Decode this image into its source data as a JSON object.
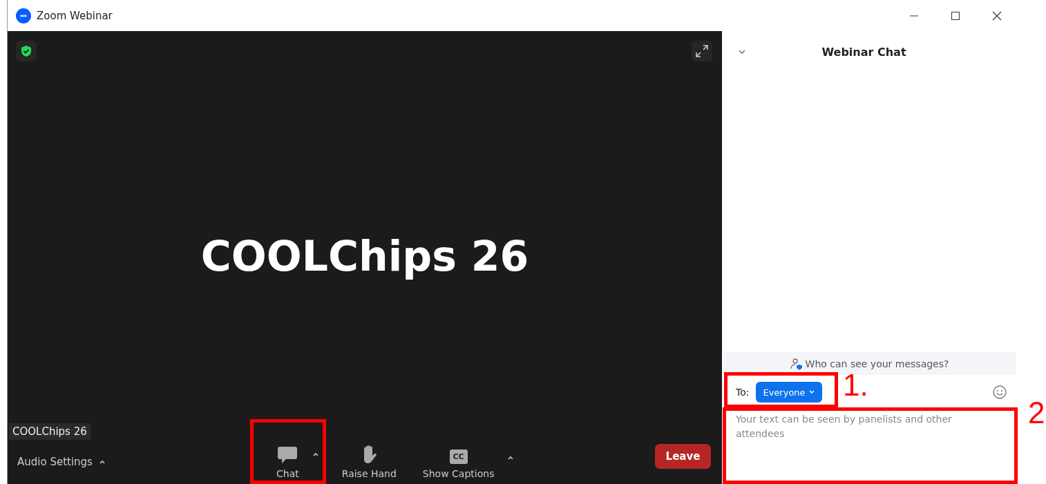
{
  "window": {
    "title": "Zoom Webinar"
  },
  "video": {
    "title": "COOLChips 26",
    "name_label": "COOLChips 26"
  },
  "toolbar": {
    "audio": "Audio Settings",
    "buttons": [
      {
        "kind": "chat",
        "label": "Chat",
        "menu": true
      },
      {
        "kind": "hand",
        "label": "Raise Hand",
        "menu": false
      },
      {
        "kind": "captions",
        "label": "Show Captions",
        "badge": "CC",
        "menu": true
      }
    ],
    "leave": "Leave"
  },
  "chat": {
    "title": "Webinar Chat",
    "privacy_link": "Who can see your messages?",
    "to_label": "To:",
    "recipient": "Everyone",
    "placeholder": "Your text can be seen by panelists and other attendees"
  },
  "annotations": [
    {
      "kind": "chat-button"
    },
    {
      "kind": "recipient",
      "label": "1."
    },
    {
      "kind": "input",
      "label": "2"
    }
  ]
}
